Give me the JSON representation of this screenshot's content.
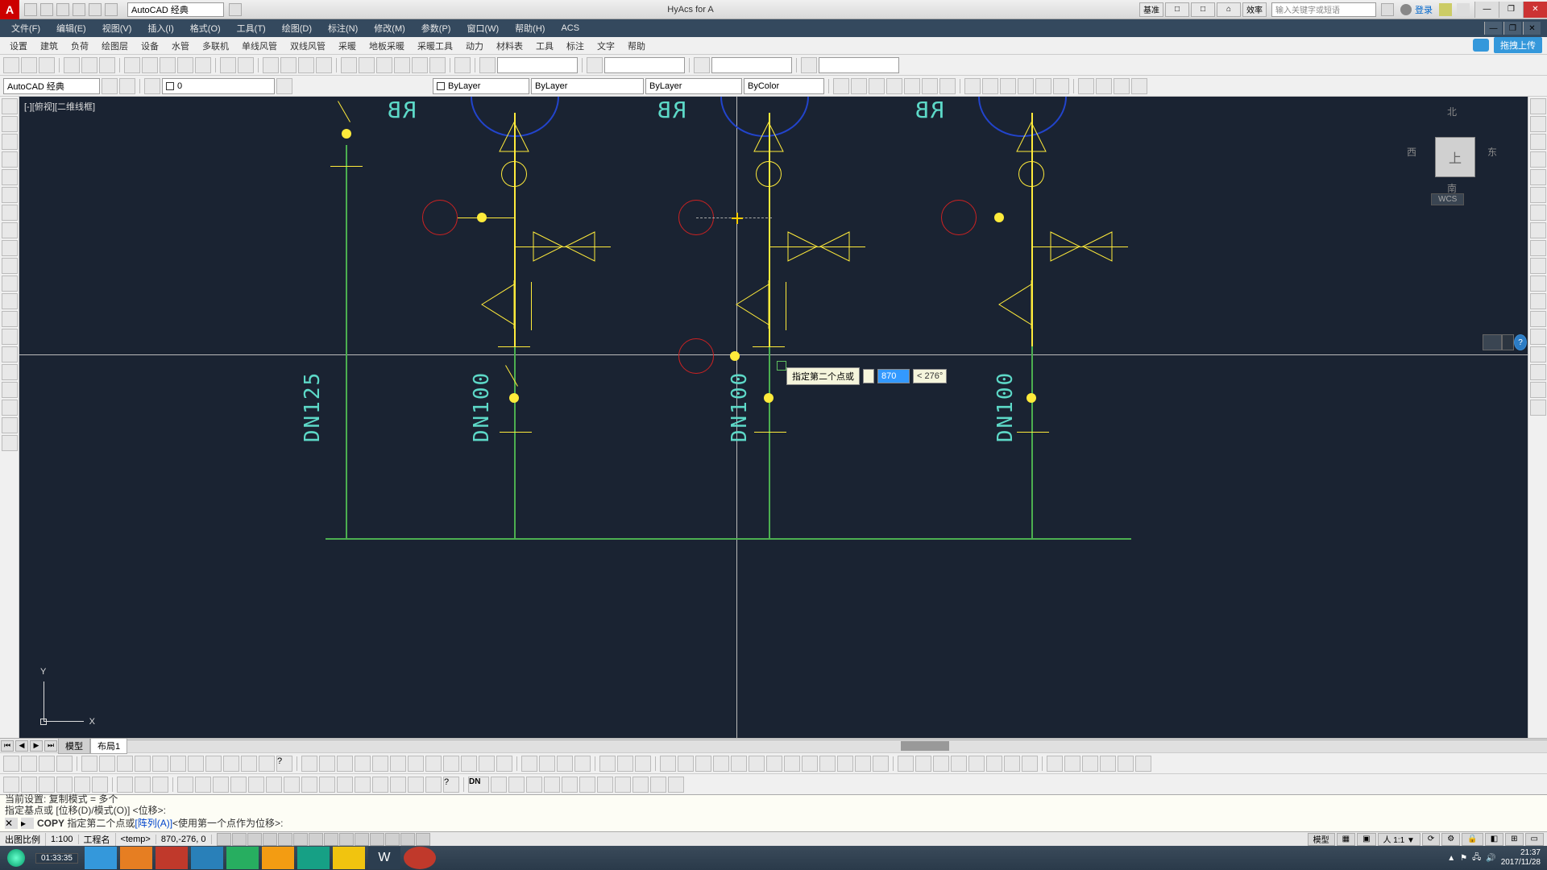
{
  "title": {
    "app_label": "A",
    "workspace_dropdown": "AutoCAD 经典",
    "center_text": "HyAcs for A",
    "tabs": [
      "基准",
      "□",
      "□",
      "⌂",
      "效率"
    ],
    "search_placeholder": "输入关键字或短语",
    "login": "登录",
    "win": {
      "min": "—",
      "max": "❐",
      "close": "✕"
    }
  },
  "menubar": [
    "文件(F)",
    "编辑(E)",
    "视图(V)",
    "插入(I)",
    "格式(O)",
    "工具(T)",
    "绘图(D)",
    "标注(N)",
    "修改(M)",
    "参数(P)",
    "窗口(W)",
    "帮助(H)",
    "ACS"
  ],
  "cloud": {
    "upload": "拖拽上传"
  },
  "menubar2": [
    "设置",
    "建筑",
    "负荷",
    "绘图层",
    "设备",
    "水管",
    "多联机",
    "单线风管",
    "双线风管",
    "采暖",
    "地板采暖",
    "采暖工具",
    "动力",
    "材料表",
    "工具",
    "标注",
    "文字",
    "帮助"
  ],
  "layer_panel": {
    "workspace": "AutoCAD 经典",
    "layer": "0",
    "color": "ByLayer",
    "linetype": "ByLayer",
    "lineweight": "ByLayer",
    "plot": "ByColor"
  },
  "canvas": {
    "view_label": "[-][俯视][二维线框]",
    "nav": {
      "n": "北",
      "s": "南",
      "e": "东",
      "w": "西",
      "cube": "上",
      "wcs": "WCS"
    },
    "help_icon": "?",
    "texts": {
      "dn125": "DN125",
      "dn100": "DN100",
      "rb": "RB"
    },
    "ucs": {
      "x": "X",
      "y": "Y"
    },
    "dynamic_input": {
      "label": "指定第二个点或",
      "dist": "870",
      "angle_prefix": "<",
      "angle": "276°"
    }
  },
  "model_tabs": {
    "model": "模型",
    "layout1": "布局1"
  },
  "command": {
    "hist1": "当前设置:  复制模式 = 多个",
    "hist2": "指定基点或 [位移(D)/模式(O)] <位移>:",
    "cmd_name": "COPY",
    "cmd_prompt": "指定第二个点或 ",
    "cmd_opts": "[阵列(A)]",
    "cmd_tail": " <使用第一个点作为位移>:"
  },
  "status": {
    "scale_label": "出图比例",
    "scale": "1:100",
    "proj_label": "工程名",
    "proj": "<temp>",
    "coords": "870,-276, 0",
    "right_model": "模型"
  },
  "taskbar": {
    "rec_time": "01:33:35",
    "time": "21:37",
    "date": "2017/11/28"
  }
}
